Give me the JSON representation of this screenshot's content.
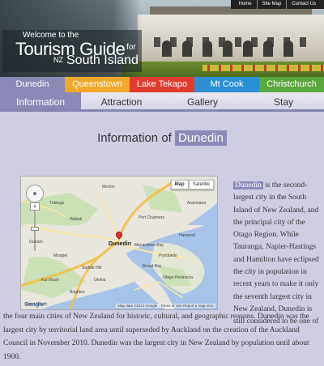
{
  "topnav": {
    "items": [
      "Home",
      "Site Map",
      "Contact Us"
    ]
  },
  "banner": {
    "welcome": "Welcome to the",
    "title": "Tourism Guide",
    "for": "for",
    "nz": "NZ",
    "region": "South Island"
  },
  "cities": [
    {
      "label": "Dunedin",
      "color": "#8a88b4"
    },
    {
      "label": "Queenstown",
      "color": "#f0a92a"
    },
    {
      "label": "Lake Tekapo",
      "color": "#e23a2e"
    },
    {
      "label": "Mt Cook",
      "color": "#2a8fd3"
    },
    {
      "label": "Christchurch",
      "color": "#5aa83e"
    }
  ],
  "sections": [
    "Information",
    "Attraction",
    "Gallery",
    "Stay"
  ],
  "active_section": "Information",
  "heading": {
    "prefix": "Information of",
    "city": "Dunedin"
  },
  "map": {
    "tab_map": "Map",
    "tab_satellite": "Satellite",
    "footer": "Map data ©2013 Google · Terms of Use   Report a map error",
    "logo": "Google",
    "labels": {
      "dunedin": "Dunedin",
      "waitati": "Waitati",
      "port_chalmers": "Port Chalmers",
      "portobello": "Portobello",
      "mosgiel": "Mosgiel",
      "brighton": "Brighton",
      "otago_peninsula": "Otago Peninsula",
      "taieri_mouth": "Taieri Mouth",
      "macandrew_bay": "Macandrew Bay",
      "aramoana": "Aramoana",
      "waitati_n": "Merton",
      "harwood": "Harwood",
      "otokia": "Otokia",
      "saddle_hill": "Saddle Hill",
      "outram": "Outram",
      "tuhinga": "Tuhinga",
      "kuri_bush": "Kuri Bush",
      "broad_bay": "Broad Bay"
    }
  },
  "text": {
    "highlight": "Dunedin",
    "side": "is the second-largest city in the South Island of New Zealand, and the principal city of the Otago Region. While Tauranga, Napier-Hastings and Hamilton have eclipsed the city in population in recent years to make it only the seventh largest city in New Zealand, Dunedin is still considered to be one of",
    "full": "the four main cities of New Zealand for historic, cultural, and geographic reasons. Dunedin was the largest city by territorial land area until superseded by Auckland on the creation of the Auckland Council in November 2010. Dunedin was the largest city in New Zealand by population until about 1900."
  }
}
